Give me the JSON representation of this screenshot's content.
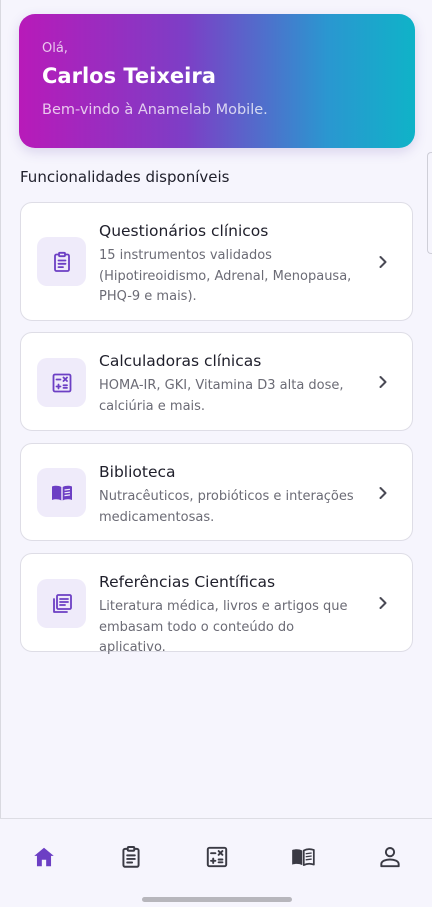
{
  "hero": {
    "greeting": "Olá,",
    "user_name": "Carlos Teixeira",
    "welcome": "Bem-vindo à Anamelab Mobile."
  },
  "section_title": "Funcionalidades disponíveis",
  "features": [
    {
      "title": "Questionários clínicos",
      "description": "15 instrumentos validados (Hipotireoidismo, Adrenal, Menopausa, PHQ-9 e mais).",
      "icon": "clipboard-icon"
    },
    {
      "title": "Calculadoras clínicas",
      "description": "HOMA-IR, GKI, Vitamina D3 alta dose, calciúria e mais.",
      "icon": "calculator-icon"
    },
    {
      "title": "Biblioteca",
      "description": "Nutracêuticos, probióticos e interações medicamentosas.",
      "icon": "book-open-icon"
    },
    {
      "title": "Referências Científicas",
      "description": "Literatura médica, livros e artigos que embasam todo o conteúdo do aplicativo.",
      "icon": "library-books-icon"
    }
  ],
  "bottom_nav": [
    {
      "icon": "home-icon",
      "active": true
    },
    {
      "icon": "clipboard-icon",
      "active": false
    },
    {
      "icon": "calculator-icon",
      "active": false
    },
    {
      "icon": "book-open-icon",
      "active": false
    },
    {
      "icon": "person-icon",
      "active": false
    }
  ],
  "colors": {
    "accent": "#6c3fc4",
    "icon_bg": "#efebfa",
    "nav_inactive": "#3a3a44"
  }
}
